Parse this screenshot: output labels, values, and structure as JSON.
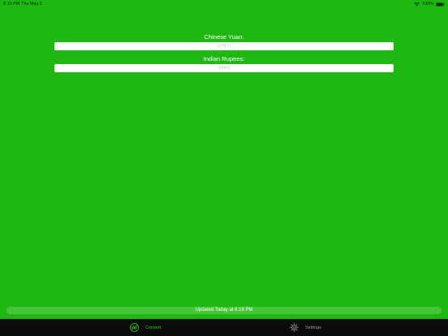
{
  "status_bar": {
    "time": "6:19 PM",
    "date": "Thu May 2",
    "battery_percent": "100%",
    "wifi_icon": "wifi-icon",
    "battery_icon": "battery-icon"
  },
  "converter": {
    "from_label": "Chinese Yuan:",
    "from_placeholder": "(CNY)",
    "to_label": "Indian Rupees:",
    "to_placeholder": "(INR)"
  },
  "update_status": "Updated Today at 6:19 PM",
  "tab_bar": {
    "tabs": [
      {
        "label": "Convert",
        "icon": "convert-icon",
        "selected": true
      },
      {
        "label": "Settings",
        "icon": "gear-icon",
        "selected": false
      }
    ]
  },
  "colors": {
    "background": "#1fb812",
    "tab_active": "#2fcf1d",
    "tab_inactive": "#9a9a9a",
    "tab_bar": "#0b0b0b"
  }
}
